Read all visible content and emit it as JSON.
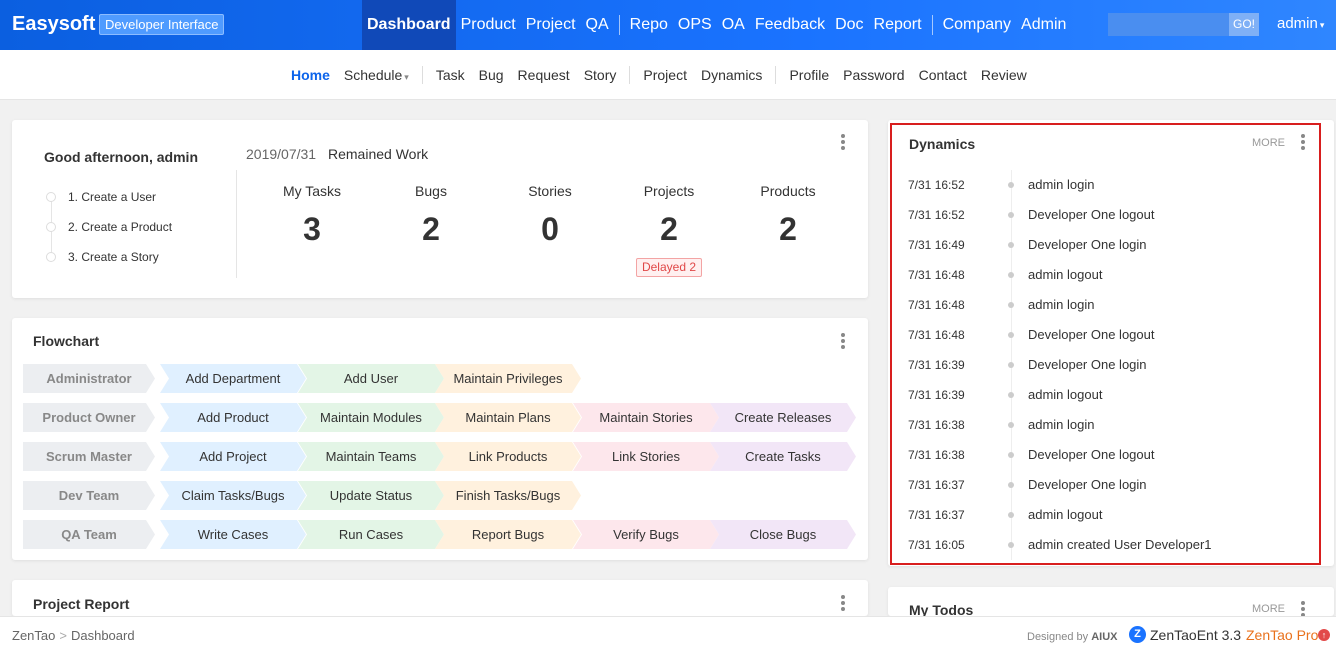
{
  "app": {
    "brand": "Easysoft",
    "badge": "Developer Interface",
    "nav": [
      "Dashboard",
      "Product",
      "Project",
      "QA",
      "Repo",
      "OPS",
      "OA",
      "Feedback",
      "Doc",
      "Report",
      "Company",
      "Admin"
    ],
    "search_button": "GO!",
    "user": "admin",
    "accent_color": "#0c64eb"
  },
  "subnav": {
    "items": [
      "Home",
      "Schedule",
      "Task",
      "Bug",
      "Request",
      "Story",
      "Project",
      "Dynamics",
      "Profile",
      "Password",
      "Contact",
      "Review"
    ]
  },
  "welcome": {
    "greeting": "Good afternoon, admin",
    "steps": [
      "1. Create a User",
      "2. Create a Product",
      "3. Create a Story"
    ],
    "date": "2019/07/31",
    "remained": "Remained Work",
    "stats": [
      {
        "label": "My Tasks",
        "value": "3"
      },
      {
        "label": "Bugs",
        "value": "2"
      },
      {
        "label": "Stories",
        "value": "0"
      },
      {
        "label": "Projects",
        "value": "2"
      },
      {
        "label": "Products",
        "value": "2"
      }
    ],
    "delayed": "Delayed 2"
  },
  "flowchart": {
    "title": "Flowchart",
    "rows": [
      [
        "Administrator",
        "Add Department",
        "Add User",
        "Maintain Privileges"
      ],
      [
        "Product Owner",
        "Add Product",
        "Maintain Modules",
        "Maintain Plans",
        "Maintain Stories",
        "Create Releases"
      ],
      [
        "Scrum Master",
        "Add Project",
        "Maintain Teams",
        "Link Products",
        "Link Stories",
        "Create Tasks"
      ],
      [
        "Dev Team",
        "Claim Tasks/Bugs",
        "Update Status",
        "Finish Tasks/Bugs"
      ],
      [
        "QA Team",
        "Write Cases",
        "Run Cases",
        "Report Bugs",
        "Verify Bugs",
        "Close Bugs"
      ]
    ]
  },
  "project_report": {
    "title": "Project Report"
  },
  "dynamics": {
    "title": "Dynamics",
    "more": "MORE",
    "items": [
      {
        "time": "7/31 16:52",
        "text": "admin login"
      },
      {
        "time": "7/31 16:52",
        "text": "Developer One logout"
      },
      {
        "time": "7/31 16:49",
        "text": "Developer One login"
      },
      {
        "time": "7/31 16:48",
        "text": "admin logout"
      },
      {
        "time": "7/31 16:48",
        "text": "admin login"
      },
      {
        "time": "7/31 16:48",
        "text": "Developer One logout"
      },
      {
        "time": "7/31 16:39",
        "text": "Developer One login"
      },
      {
        "time": "7/31 16:39",
        "text": "admin logout"
      },
      {
        "time": "7/31 16:38",
        "text": "admin login"
      },
      {
        "time": "7/31 16:38",
        "text": "Developer One logout"
      },
      {
        "time": "7/31 16:37",
        "text": "Developer One login"
      },
      {
        "time": "7/31 16:37",
        "text": "admin logout"
      },
      {
        "time": "7/31 16:05",
        "text": "admin created User Developer1"
      }
    ]
  },
  "todos": {
    "title": "My Todos",
    "more": "MORE"
  },
  "footer": {
    "crumb_root": "ZenTao",
    "crumb_sep": ">",
    "crumb_page": "Dashboard",
    "designed_prefix": "Designed by",
    "designed_by": "AIUX",
    "version": "ZenTaoEnt 3.3",
    "pro": "ZenTao Pro"
  }
}
